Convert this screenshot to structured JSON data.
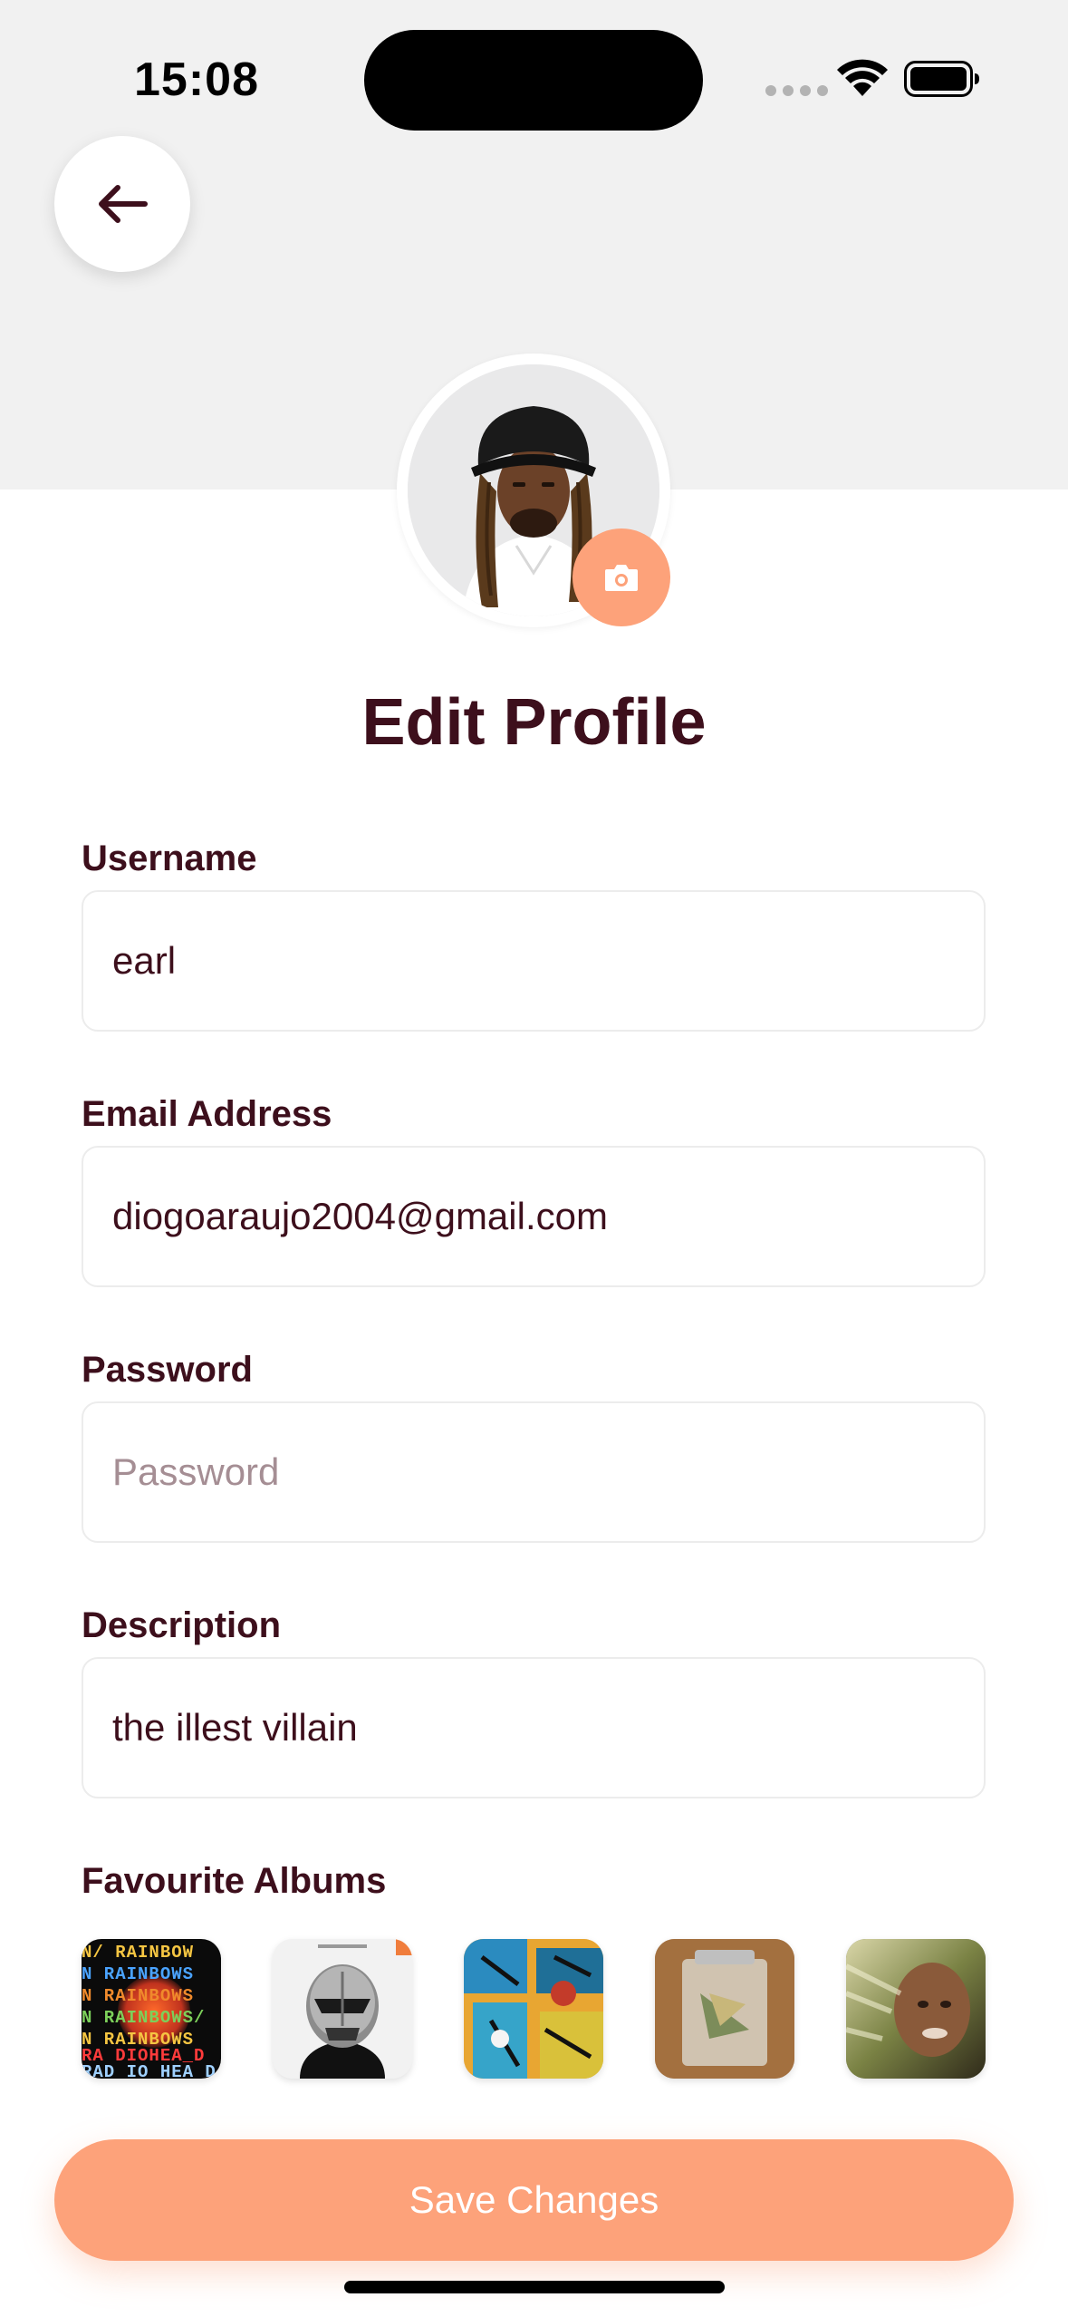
{
  "status_bar": {
    "time": "15:08"
  },
  "header": {
    "back_icon": "arrow-left-icon"
  },
  "profile": {
    "avatar_alt": "Profile photo",
    "camera_icon": "camera-icon"
  },
  "title": "Edit Profile",
  "form": {
    "username": {
      "label": "Username",
      "value": "earl",
      "placeholder": ""
    },
    "email": {
      "label": "Email Address",
      "value": "diogoaraujo2004@gmail.com",
      "placeholder": ""
    },
    "password": {
      "label": "Password",
      "value": "",
      "placeholder": "Password"
    },
    "description": {
      "label": "Description",
      "value": "the illest villain",
      "placeholder": ""
    }
  },
  "favourite_albums": {
    "label": "Favourite Albums",
    "cover_lettering": [
      "N/ RAINBOW",
      "N RAINBOWS",
      "N RAINBOWS/",
      "RA DIOHEA_D",
      "RAD IO HEA D"
    ]
  },
  "save_button": {
    "label": "Save Changes"
  },
  "colors": {
    "accent": "#fda27a",
    "text": "#3d0f1c",
    "header_background": "#f1f1f1",
    "placeholder": "#a58e94",
    "field_border": "#ececec"
  }
}
